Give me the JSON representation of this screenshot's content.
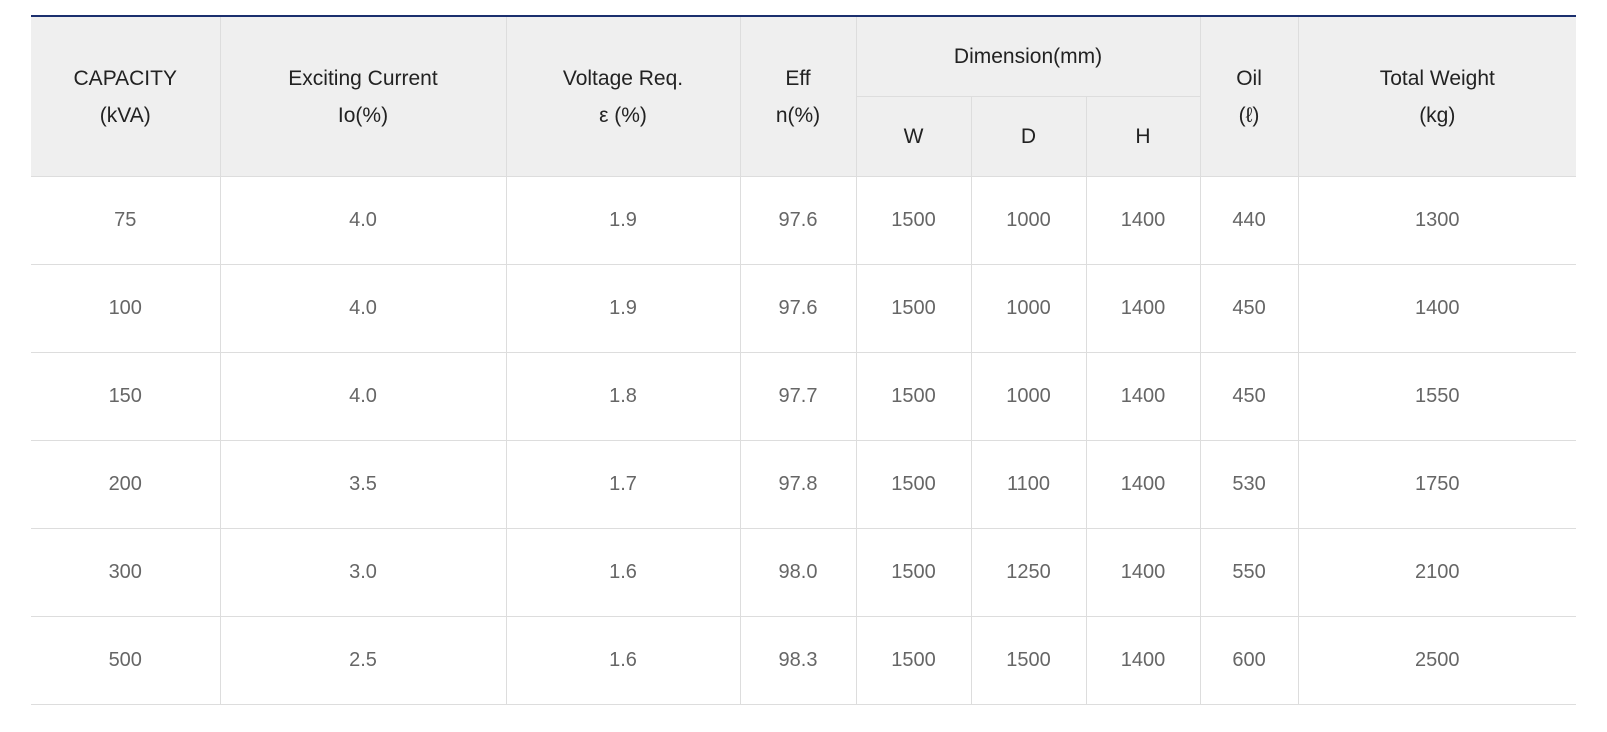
{
  "headers": {
    "capacity": {
      "line1": "CAPACITY",
      "line2": "(kVA)"
    },
    "exciting_current": {
      "line1": "Exciting Current",
      "line2": "Io(%)"
    },
    "voltage_req": {
      "line1": "Voltage Req.",
      "line2": "ε (%)"
    },
    "eff": {
      "line1": "Eff",
      "line2": "n(%)"
    },
    "dimension": {
      "label": "Dimension(mm)",
      "w": "W",
      "d": "D",
      "h": "H"
    },
    "oil": {
      "line1": "Oil",
      "line2": "(ℓ)"
    },
    "total_weight": {
      "line1": "Total Weight",
      "line2": "(kg)"
    }
  },
  "rows": [
    [
      "75",
      "4.0",
      "1.9",
      "97.6",
      "1500",
      "1000",
      "1400",
      "440",
      "1300"
    ],
    [
      "100",
      "4.0",
      "1.9",
      "97.6",
      "1500",
      "1000",
      "1400",
      "450",
      "1400"
    ],
    [
      "150",
      "4.0",
      "1.8",
      "97.7",
      "1500",
      "1000",
      "1400",
      "450",
      "1550"
    ],
    [
      "200",
      "3.5",
      "1.7",
      "97.8",
      "1500",
      "1100",
      "1400",
      "530",
      "1750"
    ],
    [
      "300",
      "3.0",
      "1.6",
      "98.0",
      "1500",
      "1250",
      "1400",
      "550",
      "2100"
    ],
    [
      "500",
      "2.5",
      "1.6",
      "98.3",
      "1500",
      "1500",
      "1400",
      "600",
      "2500"
    ]
  ],
  "colors": {
    "header_bg": "#efefef",
    "top_border": "#1b2f6e",
    "grid_line": "#dddddd",
    "header_text": "#222222",
    "cell_text": "#666666"
  }
}
